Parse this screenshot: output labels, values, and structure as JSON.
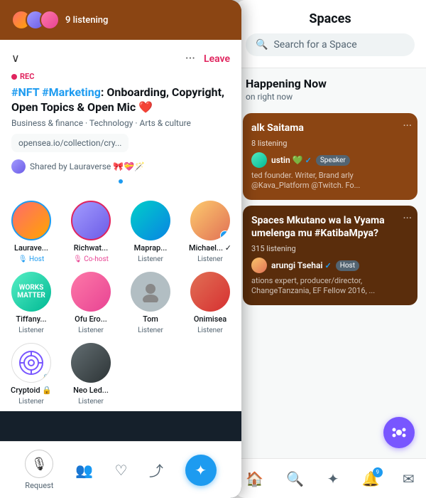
{
  "leftPanel": {
    "topBar": {
      "listeningText": "9 listening"
    },
    "card": {
      "recLabel": "REC",
      "leaveLabel": "Leave",
      "title": "#NFT #Marketing: Onboarding, Copyright, Open Topics & Open Mic ❤️",
      "categories": "Business & finance · Technology · Arts & culture",
      "link": "opensea.io/collection/cry...",
      "sharedBy": "Shared by Lauraverse 🎀💝🪄"
    },
    "participants": [
      {
        "name": "Laurave...",
        "role": "🎙 Host",
        "roleType": "host",
        "av": "av-laurave"
      },
      {
        "name": "Richwat...",
        "role": "🎙 Co-host",
        "roleType": "cohost",
        "av": "av-richwat"
      },
      {
        "name": "Maprap...",
        "role": "Listener",
        "roleType": "listener",
        "av": "av-maprap"
      },
      {
        "name": "Michael... ✓",
        "role": "Listener",
        "roleType": "listener",
        "av": "av-michael"
      },
      {
        "name": "Tiffany...",
        "role": "Listener",
        "roleType": "listener",
        "av": "av-tiffany"
      },
      {
        "name": "Ofu Ero...",
        "role": "Listener",
        "roleType": "listener",
        "av": "av-ofu"
      },
      {
        "name": "Tom",
        "role": "Listener",
        "roleType": "listener",
        "av": "av-tom"
      },
      {
        "name": "Onimisea",
        "role": "Listener",
        "roleType": "listener",
        "av": "av-onimisea"
      },
      {
        "name": "Cryptoid 🔒",
        "role": "Listener",
        "roleType": "listener",
        "av": "av-cryptoid"
      },
      {
        "name": "Neo Led...",
        "role": "Listener",
        "roleType": "listener",
        "av": "av-neo"
      }
    ],
    "bottomBar": {
      "requestLabel": "Request"
    }
  },
  "rightPanel": {
    "title": "Spaces",
    "searchPlaceholder": "Search for a Space",
    "happeningTitle": "Happening Now",
    "happeningSub": "on right now",
    "spaces": [
      {
        "title": "alk Saitama",
        "listening": "8 listening",
        "speakerName": "ustin 💚 ✓",
        "speakerRole": "Speaker",
        "speakerDesc": "ted founder. Writer, Brand\narly @Kava_Platform @Twitch. Fo..."
      },
      {
        "title": "Spaces Mkutano wa\nla Vyama umelenga\nmu #KatibaMpya?",
        "listening": "315 listening",
        "speakerName": "arungi Tsehai ✓",
        "speakerRole": "Host",
        "speakerDesc": "ations expert, producer/director,\nChangeTanzania, EF Fellow 2016, ..."
      }
    ]
  }
}
